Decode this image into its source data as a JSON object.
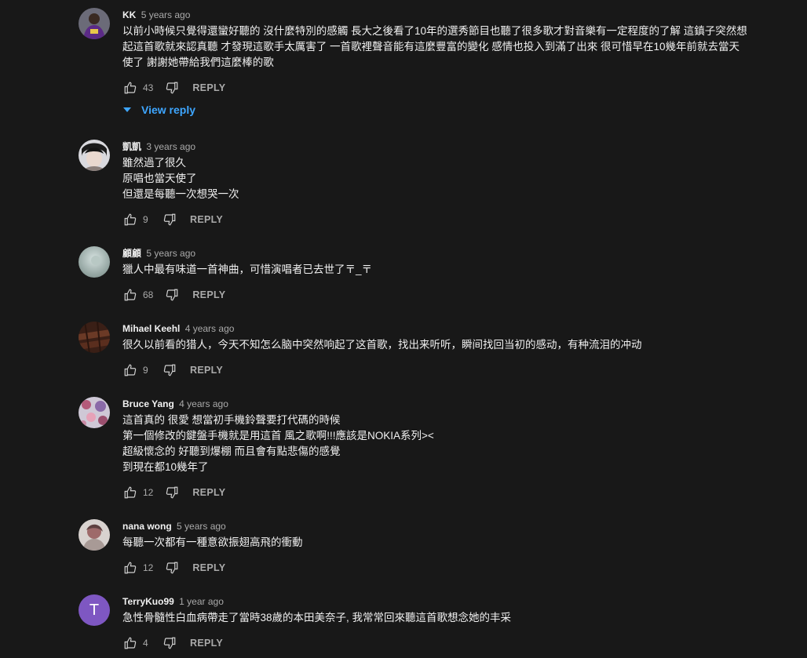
{
  "reply_label": "REPLY",
  "comments": [
    {
      "author": "KK",
      "time": "5 years ago",
      "lines": [
        "以前小時候只覺得還蠻好聽的 沒什麼特別的感觸 長大之後看了10年的選秀節目也聽了很多歌才對音樂有一定程度的了解 這鎮子突然想",
        "起這首歌就來認真聽 才發現這歌手太厲害了 一首歌裡聲音能有這麼豐富的變化 感情也投入到滿了出來  很可惜早在10幾年前就去當天",
        "使了 謝謝她帶給我們這麼棒的歌"
      ],
      "likes": "43",
      "view_reply": "View reply"
    },
    {
      "author": "凱凱",
      "time": "3 years ago",
      "lines": [
        "雖然過了很久",
        "原唱也當天使了",
        "但還是每聽一次想哭一次"
      ],
      "likes": "9"
    },
    {
      "author": "顧顧",
      "time": "5 years ago",
      "lines": [
        "獵人中最有味道一首神曲，可惜演唱者已去世了〒_〒"
      ],
      "likes": "68"
    },
    {
      "author": "Mihael Keehl",
      "time": "4 years ago",
      "lines": [
        "很久以前看的猎人，今天不知怎么脑中突然响起了这首歌，找出来听听，瞬间找回当初的感动，有种流泪的冲动"
      ],
      "likes": "9"
    },
    {
      "author": "Bruce Yang",
      "time": "4 years ago",
      "lines": [
        "這首真的 很愛 想當初手機鈴聲要打代碼的時候",
        "第一個修改的鍵盤手機就是用這首 風之歌啊!!!應該是NOKIA系列><",
        "超級懷念的 好聽到爆棚 而且會有點悲傷的感覺",
        "到現在都10幾年了"
      ],
      "likes": "12"
    },
    {
      "author": "nana wong",
      "time": "5 years ago",
      "lines": [
        "每聽一次都有一種意欲振翅高飛的衝動"
      ],
      "likes": "12"
    },
    {
      "author": "TerryKuo99",
      "time": "1 year ago",
      "avatar_letter": "T",
      "lines": [
        "急性骨髓性白血病帶走了當時38歲的本田美奈子, 我常常回來聽這首歌想念她的丰采"
      ],
      "likes": "4"
    }
  ],
  "colors": {
    "background": "#181818",
    "link_blue": "#3ea6ff",
    "secondary_text": "#aaaaaa",
    "avatar_purple": "#7e57c2"
  }
}
